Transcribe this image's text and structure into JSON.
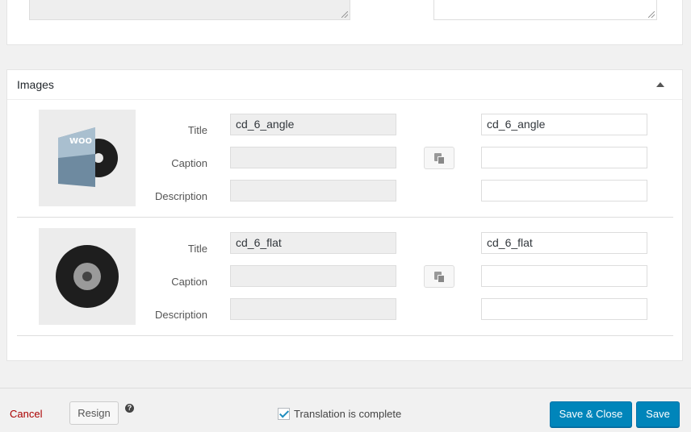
{
  "images_section": {
    "title": "Images"
  },
  "images": [
    {
      "title_label": "Title",
      "caption_label": "Caption",
      "description_label": "Description",
      "original": {
        "title": "cd_6_angle",
        "caption": "",
        "description": ""
      },
      "translation": {
        "title": "cd_6_angle",
        "caption": "",
        "description": ""
      },
      "thumb_icon": "cd-angle-thumbnail",
      "thumb_text": "WOO"
    },
    {
      "title_label": "Title",
      "caption_label": "Caption",
      "description_label": "Description",
      "original": {
        "title": "cd_6_flat",
        "caption": "",
        "description": ""
      },
      "translation": {
        "title": "cd_6_flat",
        "caption": "",
        "description": ""
      },
      "thumb_icon": "cd-flat-thumbnail"
    }
  ],
  "footer": {
    "cancel_label": "Cancel",
    "resign_label": "Resign",
    "help_symbol": "?",
    "translation_complete_label": "Translation is complete",
    "translation_complete_checked": true,
    "save_close_label": "Save & Close",
    "save_label": "Save"
  },
  "colors": {
    "primary": "#0085ba",
    "cancel": "#aa0000"
  }
}
